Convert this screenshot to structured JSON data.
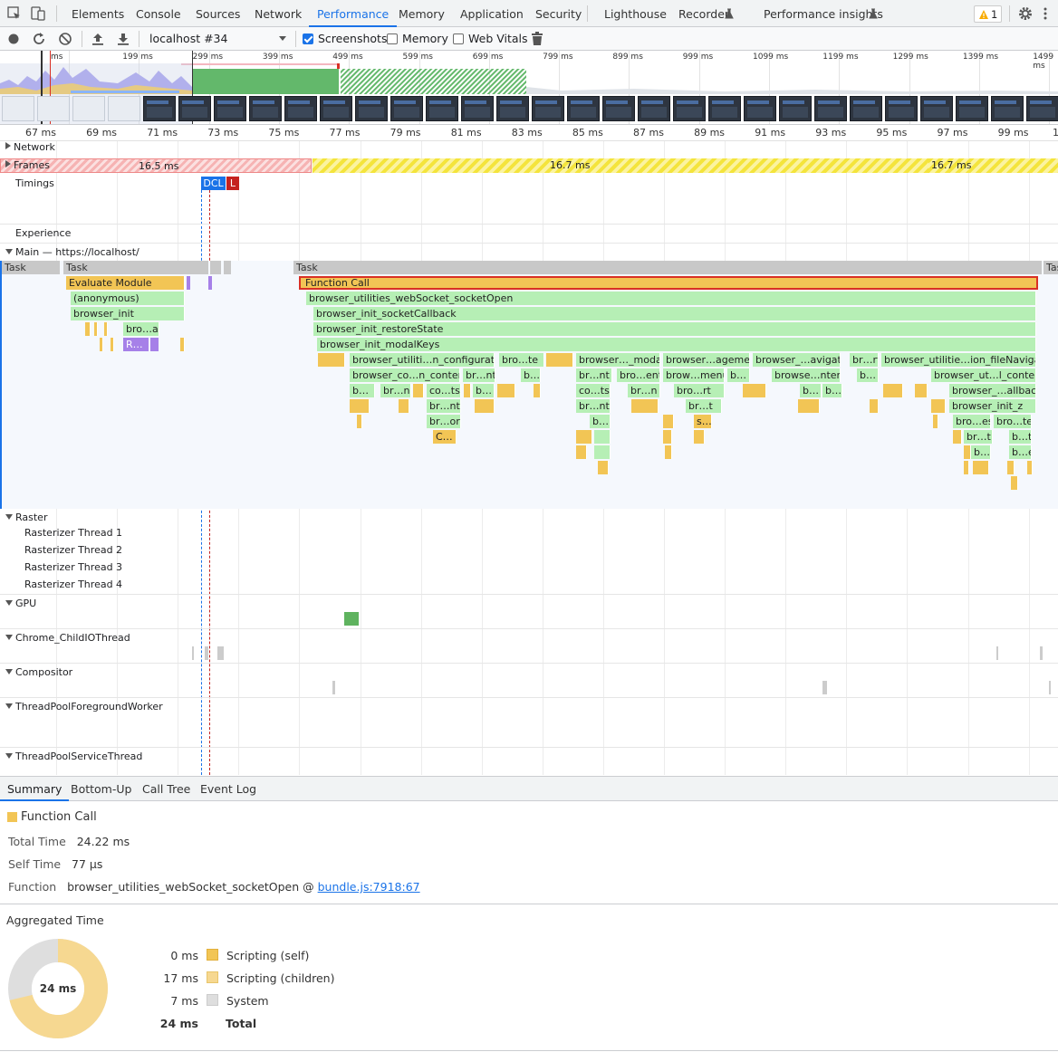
{
  "tabs": {
    "elements": "Elements",
    "console": "Console",
    "sources": "Sources",
    "network": "Network",
    "performance": "Performance",
    "memory": "Memory",
    "application": "Application",
    "security": "Security",
    "lighthouse": "Lighthouse",
    "recorder": "Recorder",
    "insights": "Performance insights",
    "warning_count": "1"
  },
  "toolbar": {
    "profile": "localhost #34",
    "screenshots": "Screenshots",
    "memory": "Memory",
    "web_vitals": "Web Vitals"
  },
  "overview_ticks": [
    "ms",
    "199 ms",
    "299 ms",
    "399 ms",
    "499 ms",
    "599 ms",
    "699 ms",
    "799 ms",
    "899 ms",
    "999 ms",
    "1099 ms",
    "1199 ms",
    "1299 ms",
    "1399 ms",
    "1499 ms"
  ],
  "ruler_ticks": [
    "67 ms",
    "69 ms",
    "71 ms",
    "73 ms",
    "75 ms",
    "77 ms",
    "79 ms",
    "81 ms",
    "83 ms",
    "85 ms",
    "87 ms",
    "89 ms",
    "91 ms",
    "93 ms",
    "95 ms",
    "97 ms",
    "99 ms",
    "1"
  ],
  "tracks": {
    "network": "Network",
    "frames": "Frames",
    "frame1": "16.5 ms",
    "frame2": "16.7 ms",
    "frame3": "16.7 ms",
    "timings": "Timings",
    "dcl": "DCL",
    "load": "L",
    "experience": "Experience",
    "main": "Main — https://localhost/",
    "raster": "Raster",
    "r1": "Rasterizer Thread 1",
    "r2": "Rasterizer Thread 2",
    "r3": "Rasterizer Thread 3",
    "r4": "Rasterizer Thread 4",
    "gpu": "GPU",
    "childio": "Chrome_ChildIOThread",
    "compositor": "Compositor",
    "tpfw": "ThreadPoolForegroundWorker",
    "tpst": "ThreadPoolServiceThread"
  },
  "flame": {
    "task": "Task",
    "task2": "Task",
    "task3": "Task",
    "task4": "Tas",
    "evaluate": "Evaluate Module",
    "anonymous": "(anonymous)",
    "binit": "browser_init",
    "broar": "bro…ar",
    "r": "R…",
    "function_call": "Function Call",
    "socketopen": "browser_utilities_webSocket_socketOpen",
    "socketcb": "browser_init_socketCallback",
    "restore": "browser_init_restoreState",
    "modalkeys": "browser_init_modalKeys",
    "l5": [
      "browser_utiliti…n_configuration",
      "bro…te",
      "browser…_modal",
      "browser…agement",
      "browser_…avigate",
      "br…rt",
      "browser_utilitie…ion_fileNavigate"
    ],
    "l6": [
      "browser_co…n_content",
      "br…nt",
      "b…",
      "br…nt",
      "bro…ent",
      "brow…menu",
      "b…",
      "browse…ntent",
      "b…",
      "browser_ut…l_content"
    ],
    "l7": [
      "b…",
      "br…n",
      "co…ts",
      "b…",
      "co…ts",
      "br…n",
      "bro…rt",
      "b…",
      "b…",
      "browser_…allback"
    ],
    "l8": [
      "br…nt",
      "br…nt",
      "br…t",
      "browser_init_z"
    ],
    "l9": [
      "br…or",
      "b…",
      "s…",
      "bro…es",
      "bro…te"
    ],
    "l10": [
      "C…",
      "br…t",
      "b…t"
    ],
    "l11": [
      "b…",
      "b…e"
    ]
  },
  "bottom": {
    "tabs": [
      "Summary",
      "Bottom-Up",
      "Call Tree",
      "Event Log"
    ],
    "title": "Function Call",
    "total_time_label": "Total Time",
    "total_time": "24.22 ms",
    "self_time_label": "Self Time",
    "self_time": "77 µs",
    "function_label": "Function",
    "function_name": "browser_utilities_webSocket_socketOpen @",
    "function_link": "bundle.js:7918:67",
    "aggregated": "Aggregated Time",
    "donut_center": "24 ms",
    "legend": [
      {
        "value": "0 ms",
        "label": "Scripting (self)",
        "color": "#f2c555"
      },
      {
        "value": "17 ms",
        "label": "Scripting (children)",
        "color": "#f6d891"
      },
      {
        "value": "7 ms",
        "label": "System",
        "color": "#dedede"
      },
      {
        "value": "24 ms",
        "label": "Total",
        "color": ""
      }
    ]
  },
  "colors": {
    "accent": "#1a73e8",
    "scripting": "#f2c555",
    "js_green": "#b6efb5",
    "frame_yellow": "#f4e43c"
  }
}
